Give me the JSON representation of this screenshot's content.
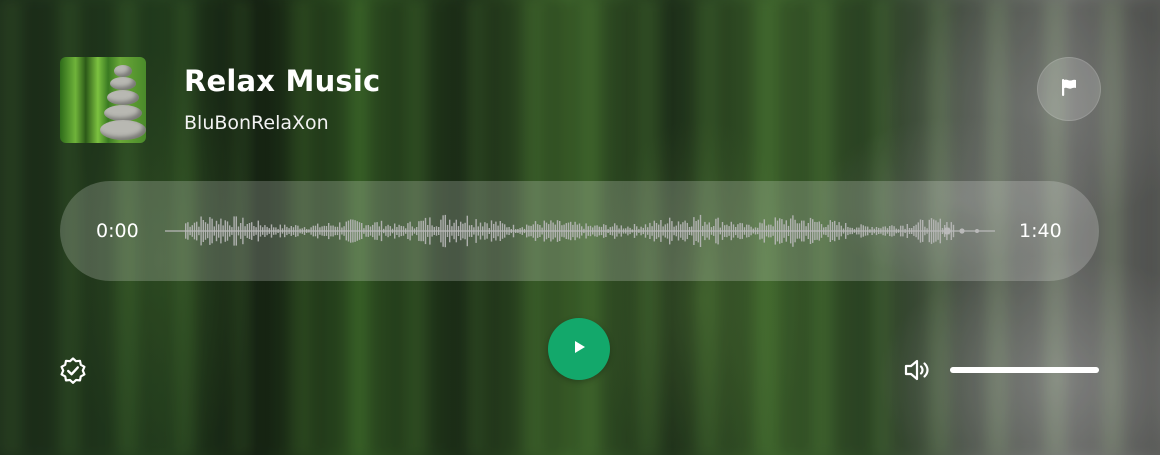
{
  "track": {
    "title": "Relax Music",
    "artist": "BluBonRelaXon"
  },
  "playback": {
    "current_time": "0:00",
    "total_time": "1:40",
    "volume": 1.0
  },
  "icons": {
    "flag": "flag-icon",
    "play": "play-icon",
    "badge": "verified-badge-icon",
    "volume": "volume-icon"
  },
  "colors": {
    "accent": "#13a86b",
    "waveform": "#b9b9b9",
    "text": "#ffffff"
  }
}
